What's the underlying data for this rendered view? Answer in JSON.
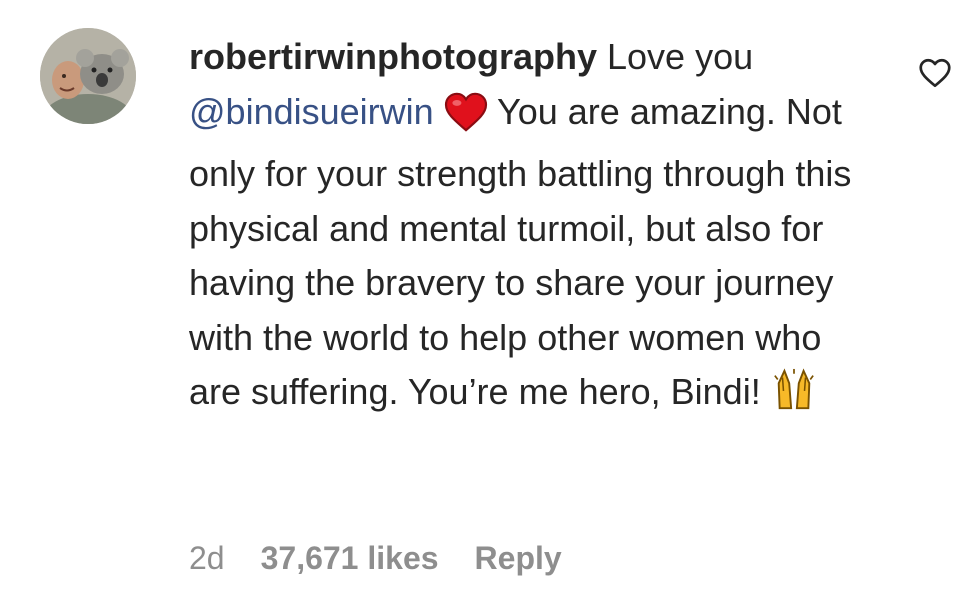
{
  "comment": {
    "username": "robertirwinphotography",
    "text_before_mention": "Love you",
    "mention": "@bindisueirwin",
    "text_after_mention": "You are amazing. Not only for your strength battling through this physical and mental turmoil, but also for having the bravery to share your journey with the world to help other women who are suffering. You’re me hero, Bindi!",
    "emojis": [
      "red-heart-icon",
      "raising-hands-icon"
    ],
    "timestamp": "2d",
    "likes": "37,671 likes",
    "reply_label": "Reply"
  },
  "colors": {
    "text": "#262626",
    "mention": "#385185",
    "meta": "#8e8e8e",
    "heart_red": "#e0111c",
    "raising_hands": "#f7b928"
  }
}
